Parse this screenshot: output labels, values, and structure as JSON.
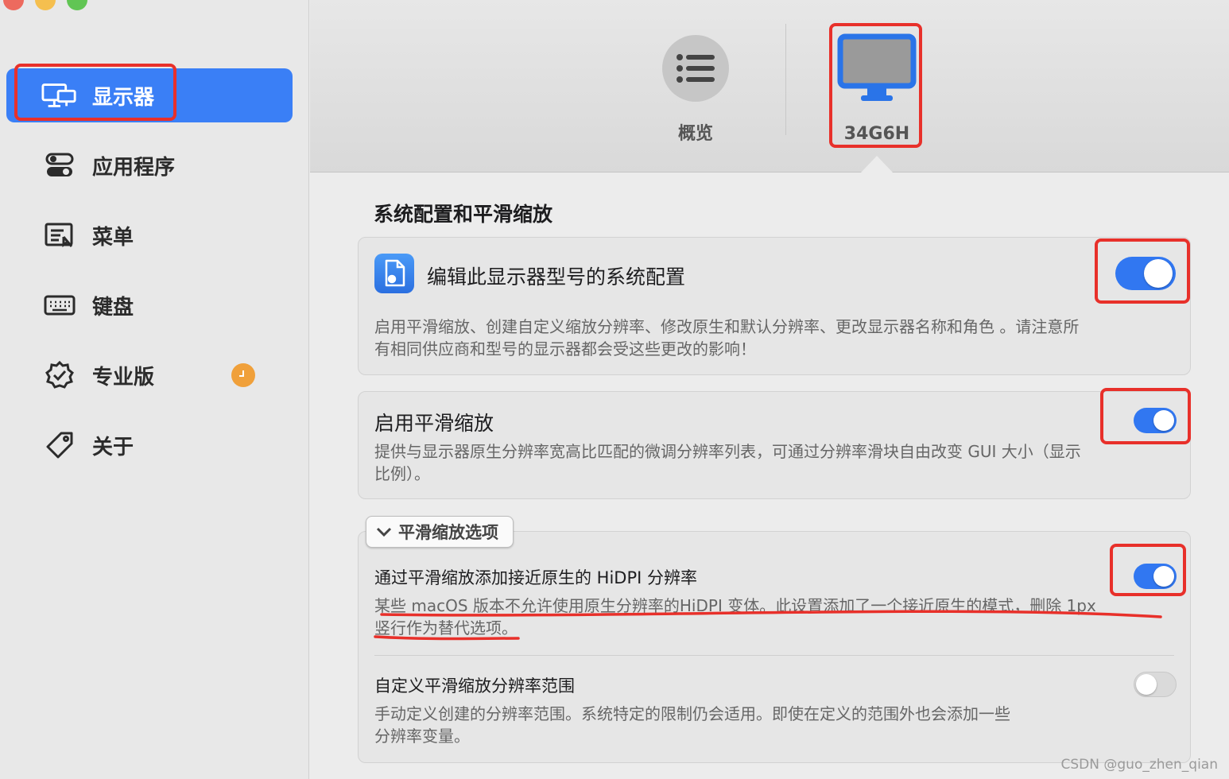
{
  "sidebar": {
    "items": [
      {
        "label": "显示器",
        "icon": "displays-icon",
        "active": true
      },
      {
        "label": "应用程序",
        "icon": "toggles-icon"
      },
      {
        "label": "菜单",
        "icon": "menu-icon"
      },
      {
        "label": "键盘",
        "icon": "keyboard-icon"
      },
      {
        "label": "专业版",
        "icon": "seal-check-icon",
        "badge": "clock-badge"
      },
      {
        "label": "关于",
        "icon": "tag-icon"
      }
    ]
  },
  "header": {
    "tabs": [
      {
        "label": "概览",
        "icon": "list-icon"
      },
      {
        "label": "34G6H",
        "icon": "monitor-icon",
        "selected": true
      }
    ]
  },
  "content": {
    "section_title": "系统配置和平滑缩放",
    "card1": {
      "title": "编辑此显示器型号的系统配置",
      "desc_line1": "启用平滑缩放、创建自定义缩放分辨率、修改原生和默认分辨率、更改显示器名称和角色 。请注意所",
      "desc_line2": "有相同供应商和型号的显示器都会受这些更改的影响！",
      "toggle_on": true
    },
    "card2": {
      "title": "启用平滑缩放",
      "desc_line1": "提供与显示器原生分辨率宽高比匹配的微调分辨率列表，可通过分辨率滑块自由改变 GUI 大小（显示",
      "desc_line2": "比例）。",
      "toggle_on": true
    },
    "options": {
      "disclosure_label": "平滑缩放选项",
      "row1": {
        "title": "通过平滑缩放添加接近原生的 HiDPI 分辨率",
        "desc_line1": "某些 macOS 版本不允许使用原生分辨率的HiDPI 变体。此设置添加了一个接近原生的模式，删除 1px",
        "desc_line2": "竖行作为替代选项。",
        "toggle_on": true
      },
      "row2": {
        "title": "自定义平滑缩放分辨率范围",
        "desc_line1": "手动定义创建的分辨率范围。系统特定的限制仍会适用。即使在定义的范围外也会添加一些",
        "desc_line2": "分辨率变量。",
        "toggle_on": false
      }
    }
  },
  "watermark": "CSDN @guo_zhen_qian",
  "colors": {
    "accent": "#3a7ff6",
    "annotation": "#e8302a",
    "badge": "#f0a03a"
  }
}
